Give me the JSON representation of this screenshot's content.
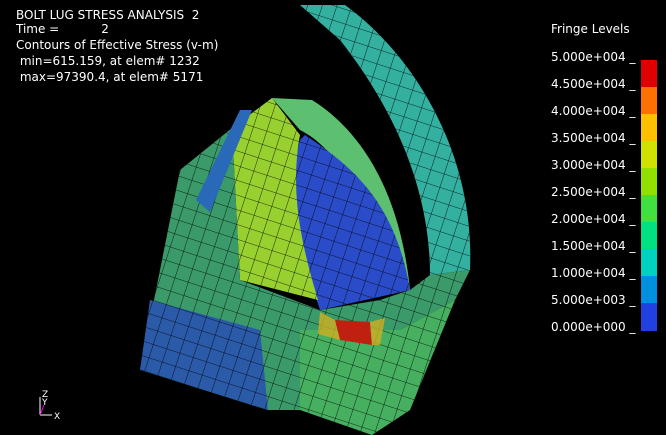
{
  "header": {
    "title": "BOLT LUG STRESS ANALYSIS  2",
    "time_label": "Time =",
    "time_value": "2",
    "contour": "Contours of Effective Stress (v-m)",
    "min": " min=615.159, at elem# 1232",
    "max": " max=97390.4, at elem# 5171"
  },
  "legend": {
    "title": "Fringe Levels",
    "levels": [
      "5.000e+004",
      "4.500e+004",
      "4.000e+004",
      "3.500e+004",
      "3.000e+004",
      "2.500e+004",
      "2.000e+004",
      "1.500e+004",
      "1.000e+004",
      "5.000e+003",
      "0.000e+000"
    ],
    "colors": [
      "#e00000",
      "#ff7000",
      "#ffc000",
      "#d0e000",
      "#90e000",
      "#40e040",
      "#00e080",
      "#00d0c0",
      "#0090e0",
      "#2040e0",
      "#0000c8"
    ]
  },
  "triad": {
    "z": "Z",
    "y": "Y",
    "x": "X"
  },
  "palette": {
    "background": "#000000",
    "text": "#ffffff"
  }
}
